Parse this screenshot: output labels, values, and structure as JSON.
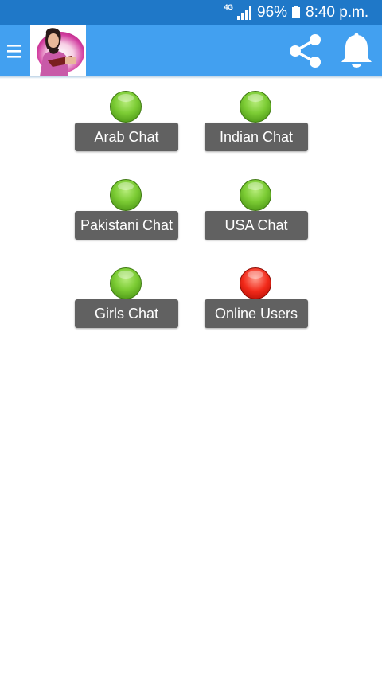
{
  "status_bar": {
    "network": "4G",
    "battery_percent": "96%",
    "time": "8:40 p.m.",
    "icons": [
      "network-4g-icon",
      "signal-icon",
      "battery-icon"
    ]
  },
  "app_bar": {
    "background_color": "#42a0f0",
    "icons": [
      "menu-icon",
      "avatar-image",
      "share-icon",
      "bell-icon"
    ]
  },
  "rooms": [
    {
      "label": "Arab Chat",
      "status": "green"
    },
    {
      "label": "Indian Chat",
      "status": "green"
    },
    {
      "label": "Pakistani Chat",
      "status": "green"
    },
    {
      "label": "USA Chat",
      "status": "green"
    },
    {
      "label": "Girls Chat",
      "status": "green"
    },
    {
      "label": "Online Users",
      "status": "red"
    }
  ],
  "colors": {
    "status_bar": "#1f78c8",
    "button": "#616161",
    "online": "#7ccc34",
    "offline": "#f22a1a"
  }
}
